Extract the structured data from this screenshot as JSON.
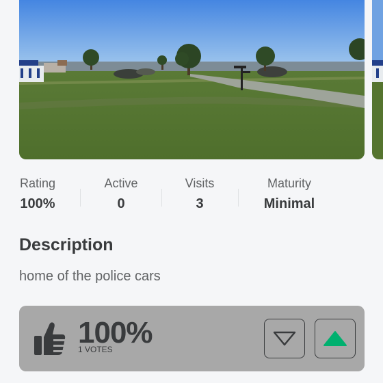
{
  "stats": [
    {
      "label": "Rating",
      "value": "100%"
    },
    {
      "label": "Active",
      "value": "0"
    },
    {
      "label": "Visits",
      "value": "3"
    },
    {
      "label": "Maturity",
      "value": "Minimal"
    }
  ],
  "description": {
    "title": "Description",
    "text": "home of the police cars"
  },
  "votes": {
    "percent": "100%",
    "count_label": "1 VOTES",
    "thumb_icon": "thumbs-up-icon",
    "down_icon": "triangle-down-icon",
    "up_icon": "triangle-up-icon",
    "up_color": "#00b06f"
  }
}
